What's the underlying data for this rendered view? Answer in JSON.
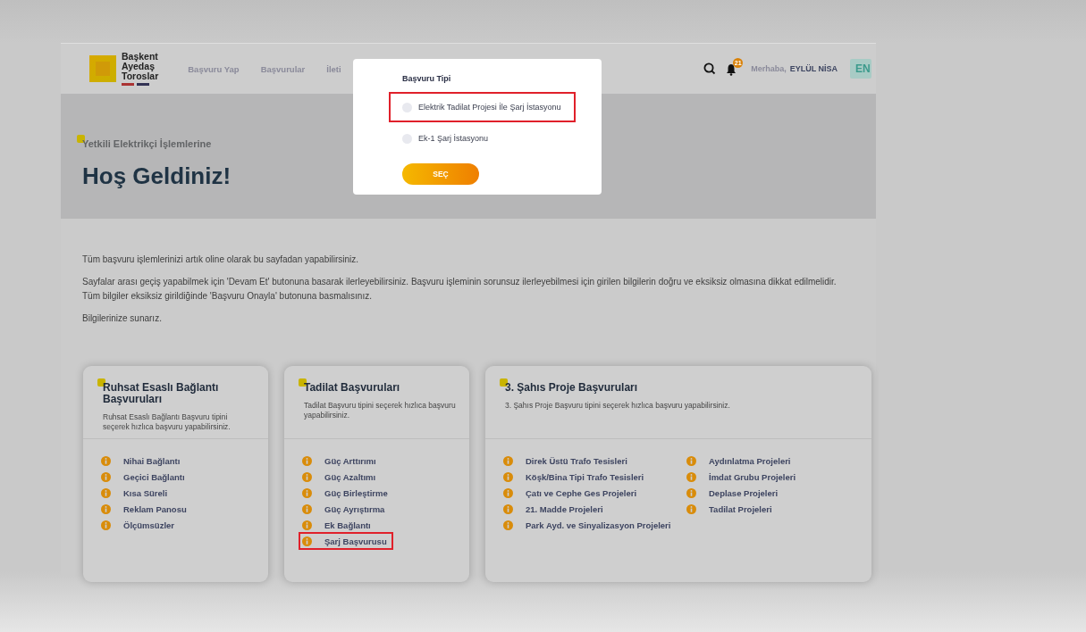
{
  "header": {
    "logo_lines": [
      "Başkent",
      "Ayedaş",
      "Toroslar"
    ],
    "nav": [
      "Başvuru Yap",
      "Başvurular",
      "İleti"
    ],
    "notification_count": "21",
    "greeting": "Merhaba,",
    "user_name": "EYLÜL NİSA",
    "language_button": "EN"
  },
  "hero": {
    "subtitle": "Yetkili Elektrikçi İşlemlerine",
    "title": "Hoş Geldiniz!"
  },
  "intro": [
    "Tüm başvuru işlemlerinizi artık oline olarak bu sayfadan yapabilirsiniz.",
    "Sayfalar arası geçiş yapabilmek için 'Devam Et' butonuna basarak ilerleyebilirsiniz. Başvuru işleminin sorunsuz ilerleyebilmesi için girilen bilgilerin doğru ve eksiksiz olmasına dikkat edilmelidir. Tüm bilgiler eksiksiz girildiğinde 'Başvuru Onayla' butonuna basmalısınız.",
    "Bilgilerinize sunarız."
  ],
  "cards": [
    {
      "title": "Ruhsat Esaslı Bağlantı Başvuruları",
      "description": "Ruhsat Esaslı Bağlantı Başvuru tipini seçerek hızlıca başvuru yapabilirsiniz.",
      "columns": [
        [
          {
            "label": "Nihai Bağlantı",
            "highlighted": false
          },
          {
            "label": "Geçici Bağlantı",
            "highlighted": false
          },
          {
            "label": "Kısa Süreli",
            "highlighted": false
          },
          {
            "label": "Reklam Panosu",
            "highlighted": false
          },
          {
            "label": "Ölçümsüzler",
            "highlighted": false
          }
        ]
      ]
    },
    {
      "title": "Tadilat Başvuruları",
      "description": "Tadilat Başvuru tipini seçerek hızlıca başvuru yapabilirsiniz.",
      "columns": [
        [
          {
            "label": "Güç Arttırımı",
            "highlighted": false
          },
          {
            "label": "Güç Azaltımı",
            "highlighted": false
          },
          {
            "label": "Güç Birleştirme",
            "highlighted": false
          },
          {
            "label": "Güç Ayrıştırma",
            "highlighted": false
          },
          {
            "label": "Ek Bağlantı",
            "highlighted": false
          },
          {
            "label": "Şarj Başvurusu",
            "highlighted": true
          }
        ]
      ]
    },
    {
      "title": "3. Şahıs Proje Başvuruları",
      "description": "3. Şahıs Proje Başvuru tipini seçerek hızlıca başvuru yapabilirsiniz.",
      "columns": [
        [
          {
            "label": "Direk Üstü Trafo Tesisleri",
            "highlighted": false
          },
          {
            "label": "Köşk/Bina Tipi Trafo Tesisleri",
            "highlighted": false
          },
          {
            "label": "Çatı ve Cephe Ges Projeleri",
            "highlighted": false
          },
          {
            "label": "21. Madde Projeleri",
            "highlighted": false
          },
          {
            "label": "Park Ayd. ve Sinyalizasyon Projeleri",
            "highlighted": false
          }
        ],
        [
          {
            "label": "Aydınlatma Projeleri",
            "highlighted": false
          },
          {
            "label": "İmdat Grubu Projeleri",
            "highlighted": false
          },
          {
            "label": "Deplase Projeleri",
            "highlighted": false
          },
          {
            "label": "Tadilat Projeleri",
            "highlighted": false
          }
        ]
      ]
    }
  ],
  "modal": {
    "title": "Başvuru Tipi",
    "options": [
      {
        "label": "Elektrik Tadilat Projesi İle Şarj İstasyonu",
        "selected": false,
        "highlighted": true
      },
      {
        "label": "Ek-1 Şarj İstasyonu",
        "selected": false,
        "highlighted": false
      }
    ],
    "button": "SEÇ"
  }
}
